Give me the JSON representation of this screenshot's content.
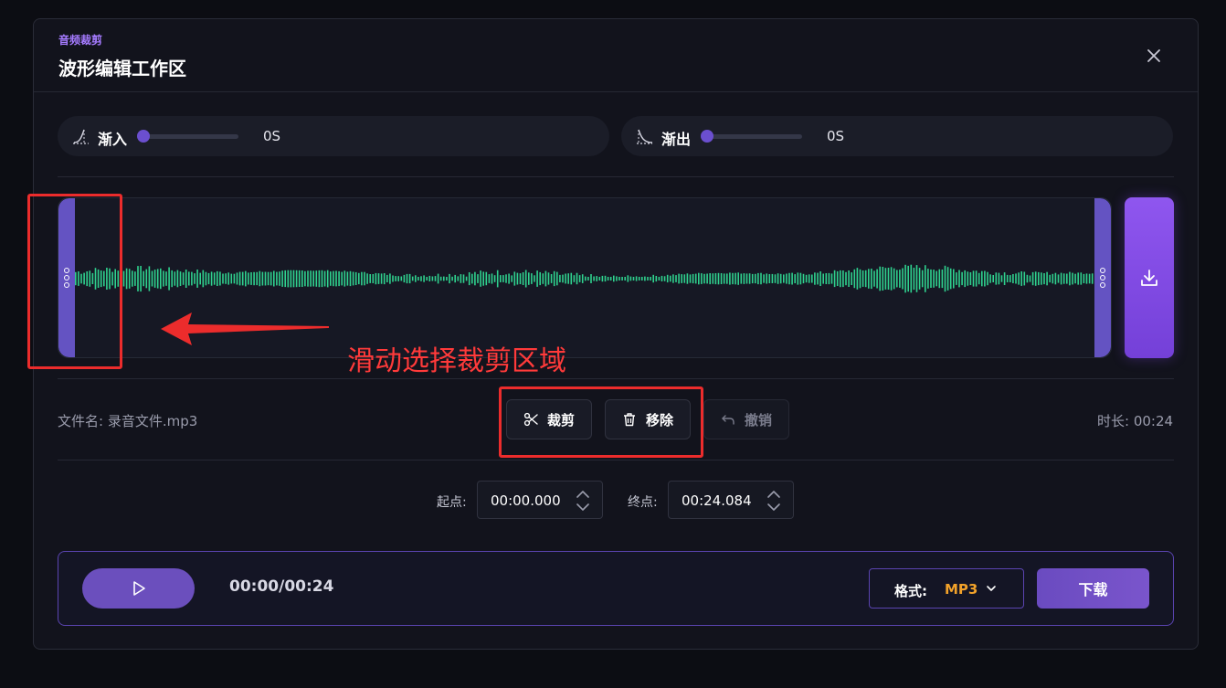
{
  "header": {
    "eyebrow": "音频裁剪",
    "title": "波形编辑工作区",
    "close_icon": "close-icon"
  },
  "fade": {
    "in": {
      "label": "渐入",
      "value": "0S",
      "level": 0,
      "icon": "fade-in-icon"
    },
    "out": {
      "label": "渐出",
      "value": "0S",
      "level": 0,
      "icon": "fade-out-icon"
    }
  },
  "waveform": {
    "color": "#2fd18e",
    "selection_start": 0,
    "selection_end": 1,
    "export_icon": "download-icon"
  },
  "annotation": {
    "text": "滑动选择裁剪区域",
    "color": "#ec2c2c"
  },
  "toolbar": {
    "file_name": "文件名: 录音文件.mp3",
    "duration": "时长: 00:24",
    "cut_label": "裁剪",
    "remove_label": "移除",
    "undo_label": "撤销"
  },
  "range": {
    "start_label": "起点:",
    "start_value": "00:00.000",
    "end_label": "终点:",
    "end_value": "00:24.084"
  },
  "player": {
    "time": "00:00/00:24",
    "format_label": "格式:",
    "format_value": "MP3",
    "download_label": "下载"
  },
  "colors": {
    "accent": "#7a55cc",
    "format_value": "#f2a22a",
    "annotation": "#ec2c2c"
  }
}
